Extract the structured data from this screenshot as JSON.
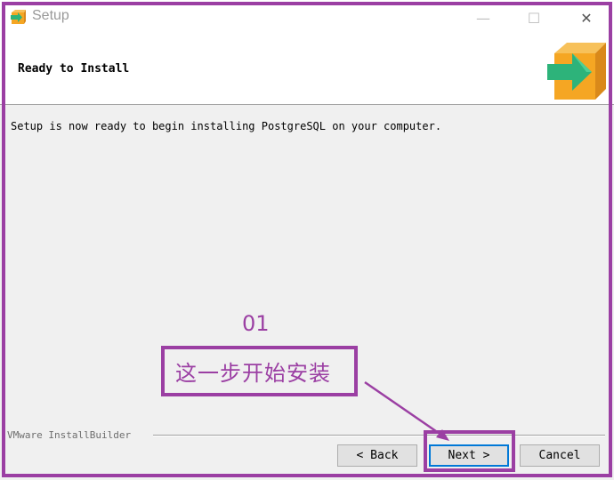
{
  "window": {
    "title": "Setup",
    "app_icon": "setup-arrow-box-icon",
    "controls": {
      "minimize": "—",
      "maximize": "☐",
      "close": "✕"
    }
  },
  "header": {
    "title": "Ready to Install",
    "logo": "install-box-arrow-icon"
  },
  "main": {
    "message": "Setup is now ready to begin installing PostgreSQL on your computer."
  },
  "annotation": {
    "step_number": "01",
    "text": "这一步开始安装",
    "color": "#9b3fa3"
  },
  "footer": {
    "brand": "VMware InstallBuilder",
    "buttons": {
      "back": "< Back",
      "next": "Next >",
      "cancel": "Cancel"
    }
  },
  "colors": {
    "accent_outline": "#9b3fa3",
    "focus_blue": "#0078d7",
    "logo_orange": "#f5a623",
    "logo_green": "#2db37a"
  }
}
